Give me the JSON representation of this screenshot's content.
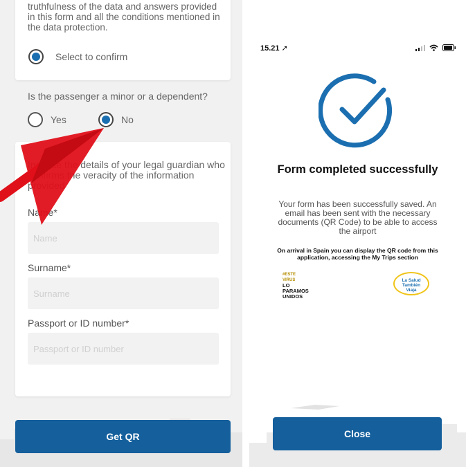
{
  "form_screen": {
    "declaration_text": "truthfulness of the data and answers provided in this form and all the conditions mentioned in the data protection.",
    "confirm_label": "Select to confirm",
    "minor_question": "Is the passenger a minor or a dependent?",
    "yes_label": "Yes",
    "no_label": "No",
    "guardian_text": "Indicate the details of your legal guardian who confirms the veracity of the information provided",
    "name_label": "Name*",
    "name_placeholder": "Name",
    "surname_label": "Surname*",
    "surname_placeholder": "Surname",
    "passport_label": "Passport or ID number*",
    "passport_placeholder": "Passport or ID number",
    "get_qr_label": "Get QR",
    "colors": {
      "primary": "#145f9c",
      "arrow": "#e0101a"
    }
  },
  "success_screen": {
    "status_time": "15.21",
    "title": "Form completed successfully",
    "message": "Your form has been successfully saved. An email has been sent with the necessary documents (QR Code) to be able to access the airport",
    "arrival_note": "On arrival in Spain you can display the QR code from this application, accessing the My Trips section",
    "logo_left_line1": "#ESTE",
    "logo_left_line2": "VIRUS",
    "logo_left_line3": "LO",
    "logo_left_line4": "PARAMOS",
    "logo_left_line5": "UNIDOS",
    "logo_right_line1": "La Salud",
    "logo_right_line2": "También",
    "logo_right_line3": "Viaja",
    "close_label": "Close",
    "colors": {
      "check": "#1b6fb0"
    }
  }
}
